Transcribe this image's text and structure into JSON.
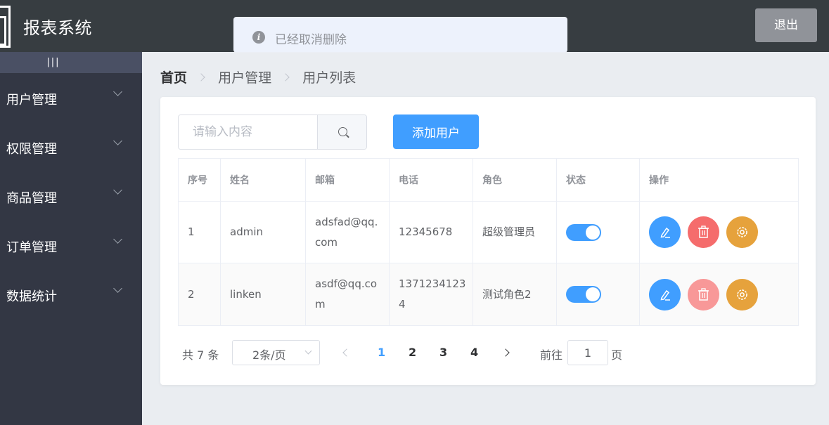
{
  "header": {
    "title": "报表系统",
    "logout_label": "退出"
  },
  "toast": {
    "message": "已经取消删除"
  },
  "sidebar": {
    "toggle_label": "|||",
    "items": [
      {
        "label": "用户管理"
      },
      {
        "label": "权限管理"
      },
      {
        "label": "商品管理"
      },
      {
        "label": "订单管理"
      },
      {
        "label": "数据统计"
      }
    ]
  },
  "breadcrumb": [
    "首页",
    "用户管理",
    "用户列表"
  ],
  "search": {
    "placeholder": "请输入内容",
    "value": ""
  },
  "add_button_label": "添加用户",
  "table": {
    "headers": [
      "序号",
      "姓名",
      "邮箱",
      "电话",
      "角色",
      "状态",
      "操作"
    ],
    "rows": [
      {
        "index": "1",
        "name": "admin",
        "email_l1": "adsfad@qq.",
        "email_l2": "com",
        "phone_l1": "12345678",
        "phone_l2": "",
        "role": "超级管理员",
        "status": true
      },
      {
        "index": "2",
        "name": "linken",
        "email_l1": "asdf@qq.co",
        "email_l2": "m",
        "phone_l1": "1371234123",
        "phone_l2": "4",
        "role": "测试角色2",
        "status": true
      }
    ]
  },
  "pagination": {
    "total_text": "共 7 条",
    "page_size_label": "2条/页",
    "pages": [
      "1",
      "2",
      "3",
      "4"
    ],
    "current_page": "1",
    "goto_label": "前往",
    "goto_value": "1",
    "page_unit": "页"
  },
  "colors": {
    "primary": "#409eff",
    "danger": "#f56c6c",
    "warning": "#e6a23c",
    "header_bg": "#373d41",
    "sidebar_bg": "#333744"
  },
  "icons": {
    "info": "info-icon",
    "search": "search-icon",
    "edit": "edit-icon",
    "delete": "delete-icon",
    "settings": "settings-icon"
  }
}
